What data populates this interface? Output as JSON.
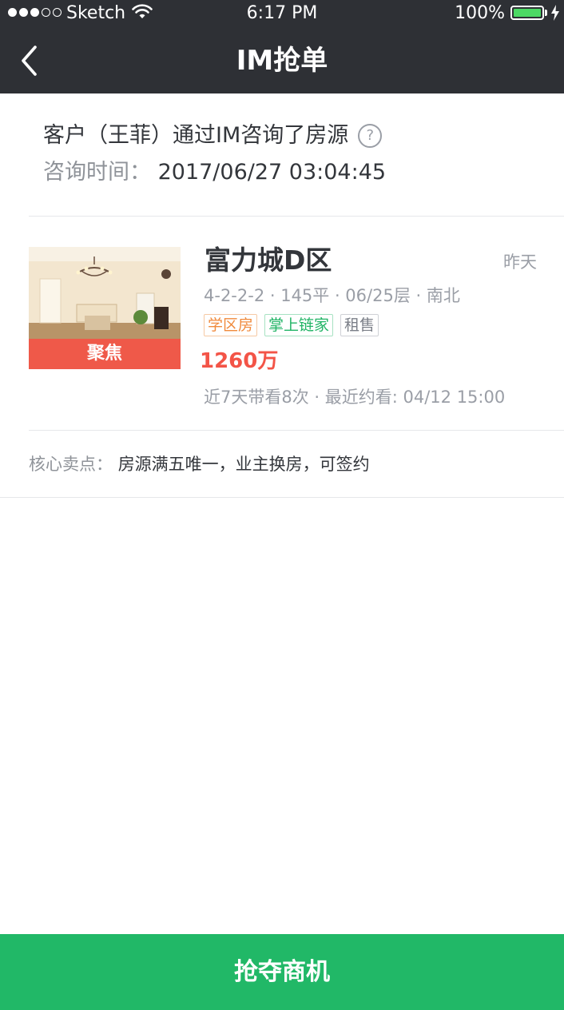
{
  "status_bar": {
    "carrier": "Sketch",
    "time": "6:17 PM",
    "battery_percent": "100%",
    "signal_bars": 3,
    "signal_total": 5
  },
  "nav": {
    "title": "IM抢单",
    "back_icon": "chevron-left-icon"
  },
  "consult": {
    "message": "客户（王菲）通过IM咨询了房源",
    "help_icon": "question-circle-icon",
    "help_glyph": "?",
    "time_label": "咨询时间：",
    "time_value": "2017/06/27 03:04:45"
  },
  "house": {
    "badge": "聚焦",
    "title": "富力城D区",
    "date": "昨天",
    "specs": "4-2-2-2 · 145平 · 06/25层 · 南北",
    "tags": [
      {
        "label": "学区房",
        "color": "orange"
      },
      {
        "label": "掌上链家",
        "color": "green"
      },
      {
        "label": "租售",
        "color": "gray"
      }
    ],
    "price": "1260万",
    "visits": "近7天带看8次 · 最近约看: 04/12  15:00"
  },
  "selling_points": {
    "label": "核心卖点：",
    "value": "房源满五唯一，业主换房，可签约"
  },
  "action": {
    "button_label": "抢夺商机"
  },
  "colors": {
    "nav_bg": "#2e3035",
    "accent_green": "#21b867",
    "price_red": "#f35447",
    "badge_red": "#f35447"
  }
}
